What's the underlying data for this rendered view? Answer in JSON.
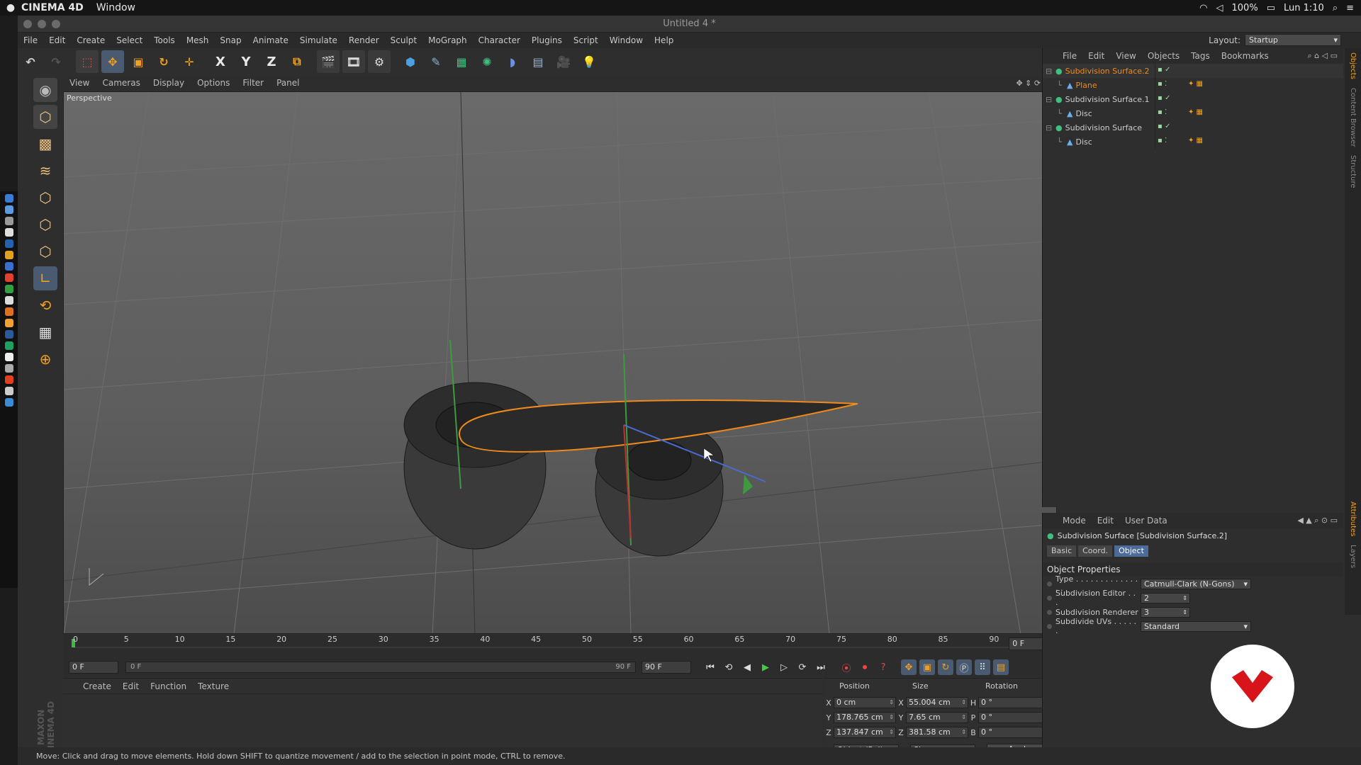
{
  "macbar": {
    "app_name": "CINEMA 4D",
    "window_menu": "Window",
    "battery": "100%",
    "clock": "Lun 1:10"
  },
  "window": {
    "title": "Untitled 4 *"
  },
  "menu": {
    "items": [
      "File",
      "Edit",
      "Create",
      "Select",
      "Tools",
      "Mesh",
      "Snap",
      "Animate",
      "Simulate",
      "Render",
      "Sculpt",
      "MoGraph",
      "Character",
      "Plugins",
      "Script",
      "Window",
      "Help"
    ],
    "layout_label": "Layout:",
    "layout_value": "Startup"
  },
  "toolbar": {
    "axis_x": "X",
    "axis_y": "Y",
    "axis_z": "Z"
  },
  "viewport": {
    "menu": [
      "View",
      "Cameras",
      "Display",
      "Options",
      "Filter",
      "Panel"
    ],
    "label": "Perspective"
  },
  "timeline": {
    "ticks": [
      "0",
      "5",
      "10",
      "15",
      "20",
      "25",
      "30",
      "35",
      "40",
      "45",
      "50",
      "55",
      "60",
      "65",
      "70",
      "75",
      "80",
      "85",
      "90"
    ],
    "current_frame": "0 F",
    "start_frame": "0 F",
    "range_start": "0 F",
    "range_end": "90 F",
    "end_frame": "90 F"
  },
  "material_panel": {
    "menu": [
      "Create",
      "Edit",
      "Function",
      "Texture"
    ]
  },
  "coordinates": {
    "headers": {
      "position": "Position",
      "size": "Size",
      "rotation": "Rotation"
    },
    "rows": [
      {
        "axis": "X",
        "pos": "0 cm",
        "size_axis": "X",
        "size": "55.004 cm",
        "rot_axis": "H",
        "rot": "0 °"
      },
      {
        "axis": "Y",
        "pos": "178.765 cm",
        "size_axis": "Y",
        "size": "7.65 cm",
        "rot_axis": "P",
        "rot": "0 °"
      },
      {
        "axis": "Z",
        "pos": "137.847 cm",
        "size_axis": "Z",
        "size": "381.58 cm",
        "rot_axis": "B",
        "rot": "0 °"
      }
    ],
    "mode_select": "Object (Rel)",
    "size_select": "Size",
    "apply": "Apply"
  },
  "objects_panel": {
    "menu": [
      "File",
      "Edit",
      "View",
      "Objects",
      "Tags",
      "Bookmarks"
    ],
    "items": [
      {
        "name": "Subdivision Surface.2",
        "indent": 0,
        "active": true
      },
      {
        "name": "Plane",
        "indent": 1,
        "active": true
      },
      {
        "name": "Subdivision Surface.1",
        "indent": 0,
        "active": false
      },
      {
        "name": "Disc",
        "indent": 1,
        "active": false
      },
      {
        "name": "Subdivision Surface",
        "indent": 0,
        "active": false
      },
      {
        "name": "Disc",
        "indent": 1,
        "active": false
      }
    ]
  },
  "attributes_panel": {
    "menu": [
      "Mode",
      "Edit",
      "User Data"
    ],
    "title": "Subdivision Surface [Subdivision Surface.2]",
    "tabs": [
      "Basic",
      "Coord.",
      "Object"
    ],
    "section": "Object Properties",
    "props": [
      {
        "label": "Type . . . . . . . . . . . . . . .",
        "value": "Catmull-Clark (N-Gons)"
      },
      {
        "label": "Subdivision Editor . . .",
        "value": "2"
      },
      {
        "label": "Subdivision Renderer",
        "value": "3"
      },
      {
        "label": "Subdivide UVs . . . . . .",
        "value": "Standard"
      }
    ]
  },
  "right_tabs": [
    "Objects",
    "Content Browser",
    "Structure",
    "Attributes",
    "Layers"
  ],
  "status": "Move: Click and drag to move elements. Hold down SHIFT to quantize movement / add to the selection in point mode, CTRL to remove.",
  "branding": "MAXON CINEMA 4D"
}
